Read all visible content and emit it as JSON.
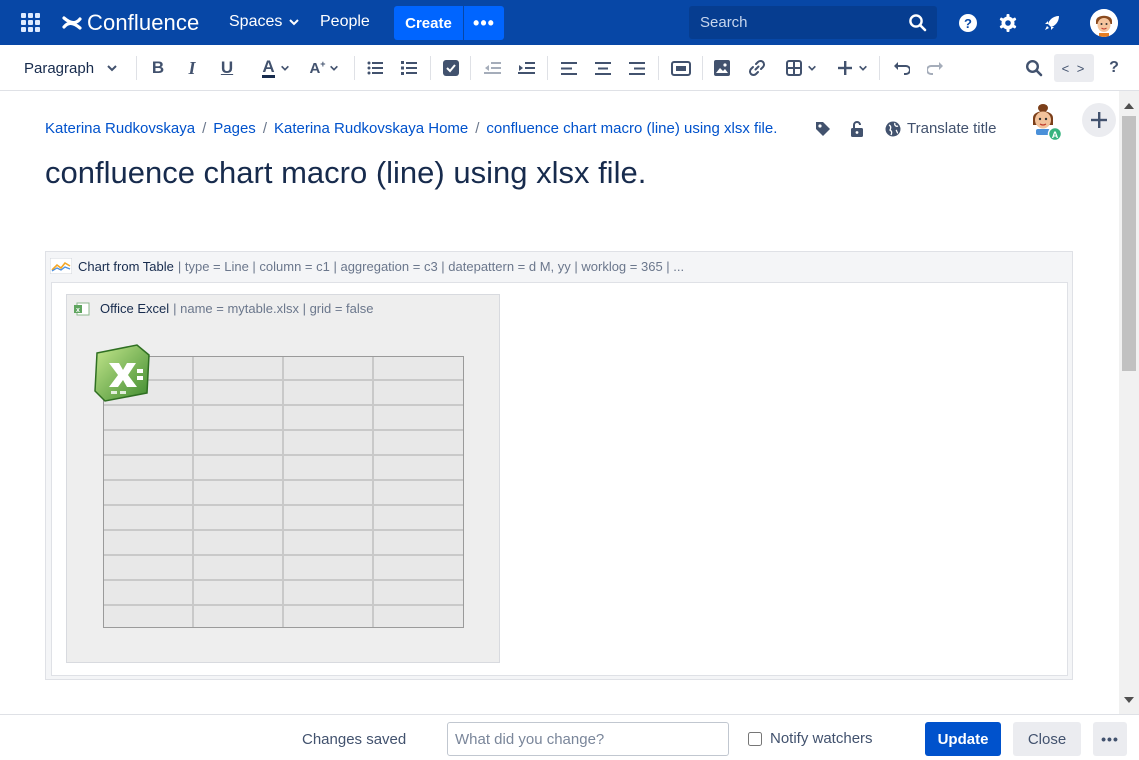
{
  "topnav": {
    "brand": "Confluence",
    "spaces_label": "Spaces",
    "people_label": "People",
    "create_label": "Create",
    "search_placeholder": "Search"
  },
  "toolbar": {
    "paragraph_label": "Paragraph",
    "source_label": "< >",
    "help_label": "?"
  },
  "breadcrumb": {
    "items": [
      "Katerina Rudkovskaya",
      "Pages",
      "Katerina Rudkovskaya Home",
      "confluence chart macro (line) using xlsx file."
    ]
  },
  "page": {
    "translate_label": "Translate title",
    "title": "confluence chart macro (line) using xlsx file.",
    "collaborator_badge": "A"
  },
  "macros": {
    "chart": {
      "name": "Chart from Table",
      "params": "| type = Line | column = c1 | aggregation = c3 | datepattern = d M, yy | worklog = 365 | ..."
    },
    "excel": {
      "name": "Office Excel",
      "params": "| name = mytable.xlsx | grid = false"
    }
  },
  "footer": {
    "status": "Changes saved",
    "comment_placeholder": "What did you change?",
    "notify_label": "Notify watchers",
    "notify_checked": false,
    "update_label": "Update",
    "close_label": "Close"
  },
  "colors": {
    "nav_bg": "#0747a6",
    "primary": "#0052cc",
    "create_bg": "#0065ff"
  }
}
